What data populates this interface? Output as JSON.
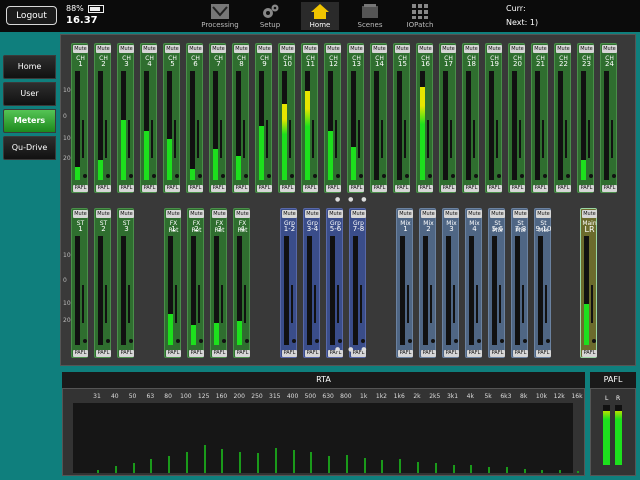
{
  "topbar": {
    "logout_label": "Logout",
    "battery": "88%",
    "time": "16.37",
    "nav": [
      {
        "label": "Processing",
        "icon": "processing-icon"
      },
      {
        "label": "Setup",
        "icon": "gear-icon"
      },
      {
        "label": "Home",
        "icon": "home-icon",
        "active": true
      },
      {
        "label": "Scenes",
        "icon": "scenes-icon"
      },
      {
        "label": "IOPatch",
        "icon": "grid-icon"
      }
    ],
    "curr_label": "Curr:",
    "next_label": "Next: 1)"
  },
  "sidebar": {
    "items": [
      {
        "label": "Home"
      },
      {
        "label": "User"
      },
      {
        "label": "Meters",
        "active": true
      },
      {
        "label": "Qu-Drive"
      }
    ]
  },
  "meters": {
    "mute_label": "Mute",
    "pafl_label": "PAFL",
    "scale": [
      "10",
      "0",
      "10",
      "20"
    ],
    "inputs": [
      {
        "type": "CH",
        "num": "1",
        "level": 0.12
      },
      {
        "type": "CH",
        "num": "2",
        "level": 0.18
      },
      {
        "type": "CH",
        "num": "3",
        "level": 0.55
      },
      {
        "type": "CH",
        "num": "4",
        "level": 0.45
      },
      {
        "type": "CH",
        "num": "5",
        "level": 0.38
      },
      {
        "type": "CH",
        "num": "6",
        "level": 0.1
      },
      {
        "type": "CH",
        "num": "7",
        "level": 0.28
      },
      {
        "type": "CH",
        "num": "8",
        "level": 0.22
      },
      {
        "type": "CH",
        "num": "9",
        "level": 0.5
      },
      {
        "type": "CH",
        "num": "10",
        "level": 0.7
      },
      {
        "type": "CH",
        "num": "11",
        "level": 0.82
      },
      {
        "type": "CH",
        "num": "12",
        "level": 0.45
      },
      {
        "type": "CH",
        "num": "13",
        "level": 0.3
      },
      {
        "type": "CH",
        "num": "14",
        "level": 0.0
      },
      {
        "type": "CH",
        "num": "15",
        "level": 0.0
      },
      {
        "type": "CH",
        "num": "16",
        "level": 0.85
      },
      {
        "type": "CH",
        "num": "17",
        "level": 0.0
      },
      {
        "type": "CH",
        "num": "18",
        "level": 0.0
      },
      {
        "type": "CH",
        "num": "19",
        "level": 0.0
      },
      {
        "type": "CH",
        "num": "20",
        "level": 0.0
      },
      {
        "type": "CH",
        "num": "21",
        "level": 0.0
      },
      {
        "type": "CH",
        "num": "22",
        "level": 0.0
      },
      {
        "type": "CH",
        "num": "23",
        "level": 0.18
      },
      {
        "type": "CH",
        "num": "24",
        "level": 0.0
      }
    ],
    "row2": [
      {
        "type": "ST",
        "num": "1",
        "level": 0.0,
        "kind": "green"
      },
      {
        "type": "ST",
        "num": "2",
        "level": 0.0,
        "kind": "green"
      },
      {
        "type": "ST",
        "num": "3",
        "level": 0.0,
        "kind": "green"
      },
      {
        "type": "FX Ret",
        "num": "1",
        "level": 0.28,
        "kind": "green"
      },
      {
        "type": "FX Ret",
        "num": "2",
        "level": 0.18,
        "kind": "green"
      },
      {
        "type": "FX Ret",
        "num": "3",
        "level": 0.2,
        "kind": "green"
      },
      {
        "type": "FX Ret",
        "num": "4",
        "level": 0.22,
        "kind": "green"
      },
      {
        "type": "Grp",
        "num": "1-2",
        "level": 0.0,
        "kind": "blue"
      },
      {
        "type": "Grp",
        "num": "3-4",
        "level": 0.0,
        "kind": "blue"
      },
      {
        "type": "Grp",
        "num": "5-6",
        "level": 0.0,
        "kind": "blue"
      },
      {
        "type": "Grp",
        "num": "7-8",
        "level": 0.0,
        "kind": "blue"
      },
      {
        "type": "Mix",
        "num": "1",
        "level": 0.0,
        "kind": "steel"
      },
      {
        "type": "Mix",
        "num": "2",
        "level": 0.0,
        "kind": "steel"
      },
      {
        "type": "Mix",
        "num": "3",
        "level": 0.0,
        "kind": "steel"
      },
      {
        "type": "Mix",
        "num": "4",
        "level": 0.0,
        "kind": "steel"
      },
      {
        "type": "St Mix",
        "num": "5-6",
        "level": 0.0,
        "kind": "steel"
      },
      {
        "type": "St Mix",
        "num": "7-8",
        "level": 0.0,
        "kind": "steel"
      },
      {
        "type": "St Mix",
        "num": "9-10",
        "level": 0.0,
        "kind": "steel"
      },
      {
        "type": "Main",
        "num": "LR",
        "level": 0.38,
        "kind": "main"
      }
    ]
  },
  "rta": {
    "title": "RTA",
    "freqs": [
      "31",
      "40",
      "50",
      "63",
      "80",
      "100",
      "125",
      "160",
      "200",
      "250",
      "315",
      "400",
      "500",
      "630",
      "800",
      "1k",
      "1k2",
      "1k6",
      "2k",
      "2k5",
      "3k1",
      "4k",
      "5k",
      "6k3",
      "8k",
      "10k",
      "12k",
      "16k"
    ],
    "bars": [
      0.05,
      0.1,
      0.15,
      0.2,
      0.25,
      0.3,
      0.4,
      0.35,
      0.3,
      0.28,
      0.36,
      0.33,
      0.3,
      0.25,
      0.26,
      0.22,
      0.18,
      0.2,
      0.16,
      0.14,
      0.12,
      0.12,
      0.09,
      0.08,
      0.06,
      0.05,
      0.04,
      0.03
    ],
    "marker_index": 5
  },
  "pafl": {
    "title": "PAFL",
    "l_label": "L",
    "r_label": "R",
    "level_l": 0.9,
    "level_r": 0.9
  }
}
